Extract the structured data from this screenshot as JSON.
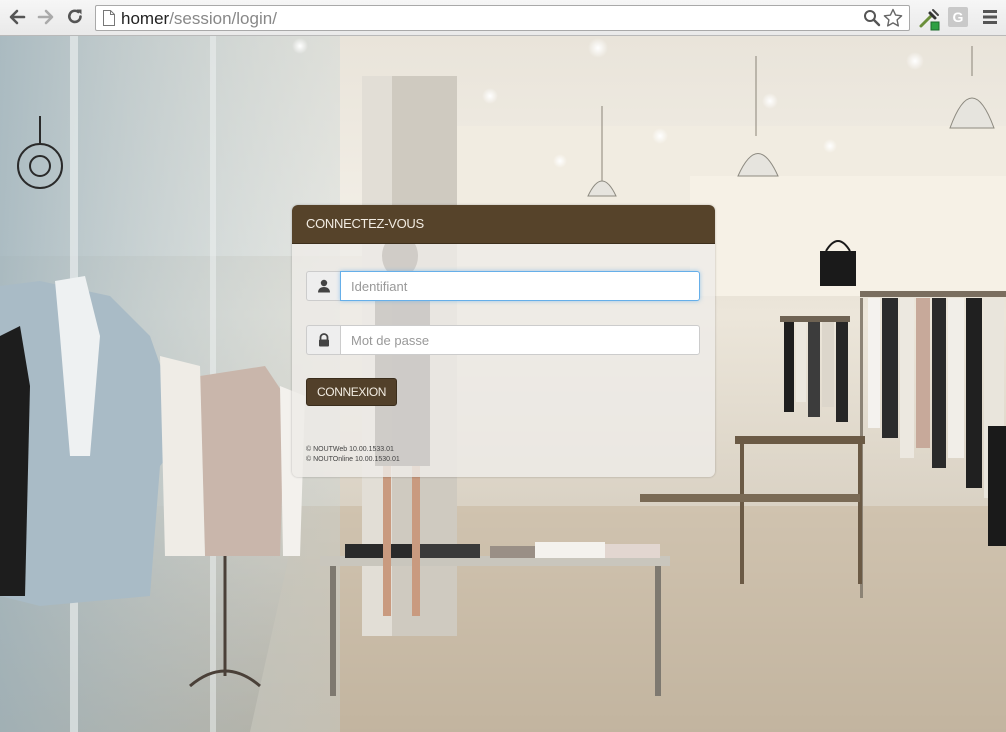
{
  "browser": {
    "url_host": "homer",
    "url_path": "/session/login/",
    "icons": {
      "back": "back-arrow-icon",
      "forward": "forward-arrow-icon",
      "reload": "reload-icon",
      "page": "page-icon",
      "zoom": "zoom-icon",
      "bookmark": "star-icon",
      "extension_1": "eyedropper-extension-icon",
      "extension_2": "g-extension-icon",
      "menu": "hamburger-menu-icon"
    },
    "extension_2_letter": "G"
  },
  "login": {
    "title": "CONNECTEZ-VOUS",
    "username_placeholder": "Identifiant",
    "password_placeholder": "Mot de passe",
    "submit_label": "CONNEXION",
    "version_web": "© NOUTWeb 10.00.1533.01",
    "version_online": "© NOUTOnline 10.00.1530.01"
  },
  "colors": {
    "header_brown": "#56432a",
    "button_brown": "#52402a",
    "focus_blue": "#66afe9"
  }
}
